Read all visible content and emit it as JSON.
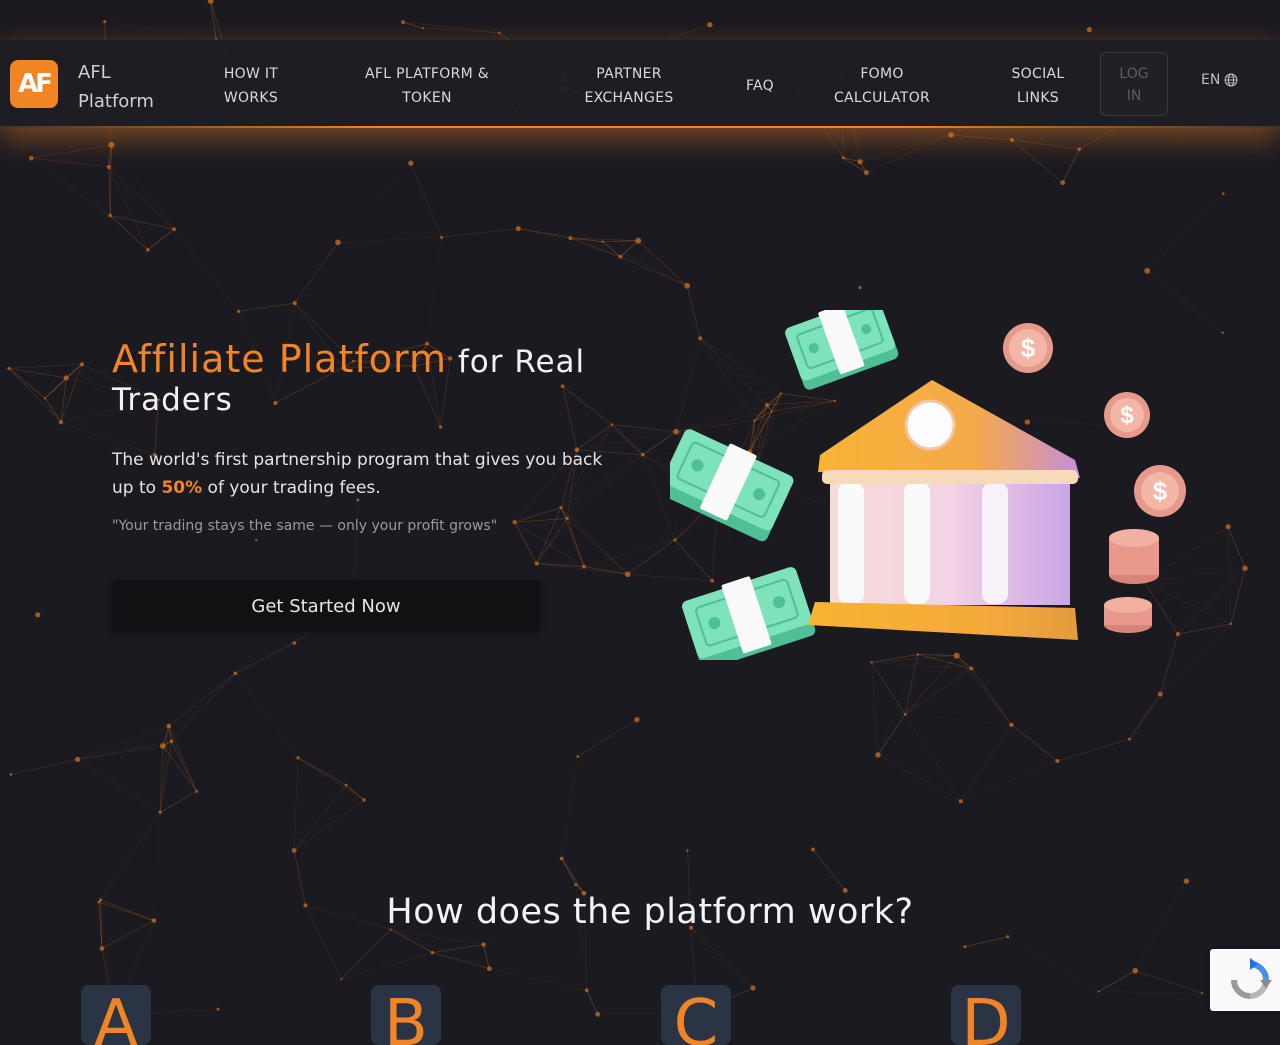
{
  "brand": {
    "mark": "AF",
    "name_line1": "AFL",
    "name_line2": "Platform"
  },
  "nav": {
    "items": [
      {
        "line1": "HOW IT",
        "line2": "WORKS"
      },
      {
        "line1": "AFL PLATFORM &",
        "line2": "TOKEN"
      },
      {
        "line1": "PARTNER",
        "line2": "EXCHANGES"
      },
      {
        "line1": "FAQ",
        "line2": ""
      },
      {
        "line1": "FOMO",
        "line2": "CALCULATOR"
      },
      {
        "line1": "SOCIAL",
        "line2": "LINKS"
      }
    ],
    "login_line1": "LOG",
    "login_line2": "IN",
    "language": "EN"
  },
  "hero": {
    "title_accent": "Affiliate Platform",
    "title_rest": " for Real Traders",
    "subtitle_before": "The world's first partnership program that gives you back up to ",
    "subtitle_highlight": "50%",
    "subtitle_after": " of your trading fees.",
    "quote": "\"Your trading stays the same — only your profit grows\"",
    "cta_label": "Get Started Now"
  },
  "illustration": {
    "coin_symbol": "$"
  },
  "how_it_works": {
    "title": "How does the platform work?",
    "steps": [
      "A",
      "B",
      "C",
      "D"
    ]
  },
  "colors": {
    "accent": "#f18425",
    "background": "#1b1a21",
    "nav_background": "#1e1d25"
  },
  "icons": {
    "language": "globe-icon",
    "recaptcha": "recaptcha-icon"
  }
}
